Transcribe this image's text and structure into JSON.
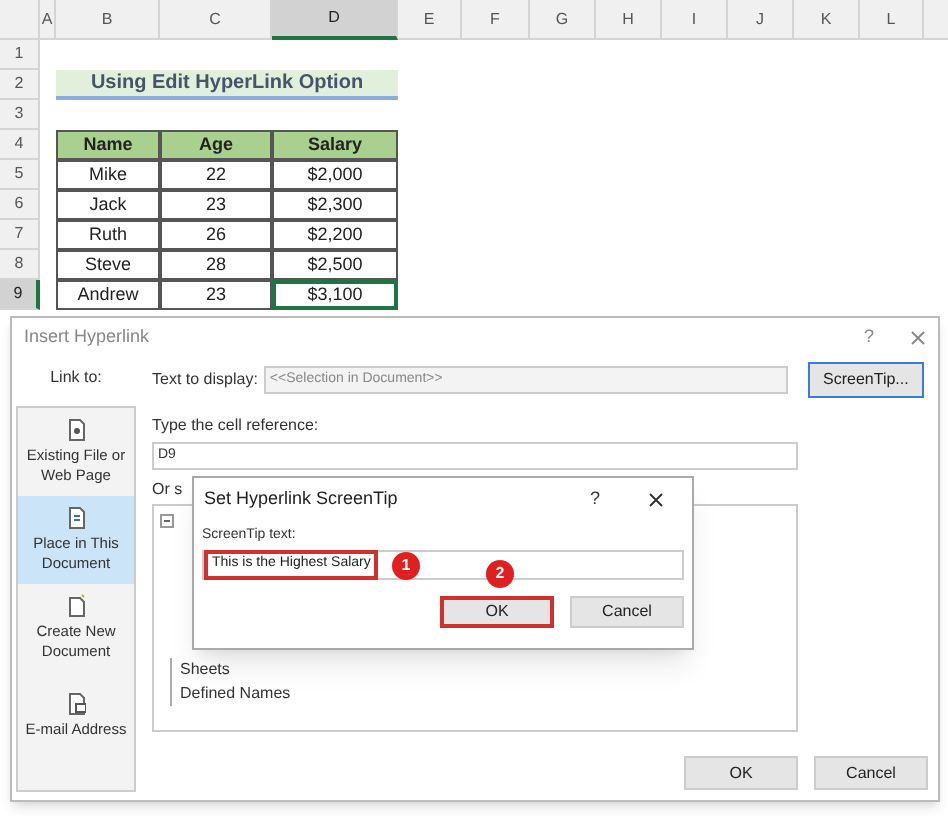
{
  "sheet": {
    "columns": [
      {
        "label": "A",
        "selected": false
      },
      {
        "label": "B",
        "selected": false
      },
      {
        "label": "C",
        "selected": false
      },
      {
        "label": "D",
        "selected": true
      },
      {
        "label": "E",
        "selected": false
      },
      {
        "label": "F",
        "selected": false
      },
      {
        "label": "G",
        "selected": false
      },
      {
        "label": "H",
        "selected": false
      },
      {
        "label": "I",
        "selected": false
      },
      {
        "label": "J",
        "selected": false
      },
      {
        "label": "K",
        "selected": false
      },
      {
        "label": "L",
        "selected": false
      }
    ],
    "rows": [
      {
        "label": "1",
        "selected": false
      },
      {
        "label": "2",
        "selected": false
      },
      {
        "label": "3",
        "selected": false
      },
      {
        "label": "4",
        "selected": false
      },
      {
        "label": "5",
        "selected": false
      },
      {
        "label": "6",
        "selected": false
      },
      {
        "label": "7",
        "selected": false
      },
      {
        "label": "8",
        "selected": false
      },
      {
        "label": "9",
        "selected": true
      }
    ],
    "title": "Using Edit HyperLink Option",
    "table": {
      "columns": [
        "Name",
        "Age",
        "Salary"
      ],
      "rows": [
        {
          "cells": [
            "Mike",
            "22",
            "$2,000"
          ],
          "selected": false
        },
        {
          "cells": [
            "Jack",
            "23",
            "$2,300"
          ],
          "selected": false
        },
        {
          "cells": [
            "Ruth",
            "26",
            "$2,200"
          ],
          "selected": false
        },
        {
          "cells": [
            "Steve",
            "28",
            "$2,500"
          ],
          "selected": false
        },
        {
          "cells": [
            "Andrew",
            "23",
            "$3,100"
          ],
          "selected": true
        }
      ]
    }
  },
  "dialog": {
    "title": "Insert Hyperlink",
    "help": "?",
    "link_to_label": "Link to:",
    "link_targets": [
      {
        "label": "Existing File or Web Page",
        "kind": "file",
        "selected": false
      },
      {
        "label": "Place in This Document",
        "kind": "place",
        "selected": true
      },
      {
        "label": "Create New Document",
        "kind": "new",
        "selected": false
      },
      {
        "label": "E-mail Address",
        "kind": "email",
        "selected": false
      }
    ],
    "text_to_display": {
      "label": "Text to display:",
      "value": "<<Selection in Document>>",
      "disabled": true
    },
    "screentip_button": "ScreenTip...",
    "cell_reference": {
      "label": "Type the cell reference:",
      "value": "D9"
    },
    "tree_label": "Or s",
    "tree_items": [
      "Sheets",
      "Defined Names"
    ],
    "buttons": [
      "OK",
      "Cancel"
    ]
  },
  "screentip_dialog": {
    "title": "Set Hyperlink ScreenTip",
    "help": "?",
    "label": "ScreenTip text:",
    "value": "This is the Highest Salary",
    "buttons": [
      {
        "label": "OK",
        "highlighted": true
      },
      {
        "label": "Cancel",
        "highlighted": false
      }
    ]
  },
  "steps": [
    "1",
    "2"
  ]
}
